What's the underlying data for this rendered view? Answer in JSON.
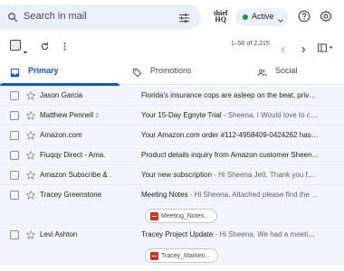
{
  "search": {
    "placeholder": "Search in mail"
  },
  "logo": {
    "line1": "thief",
    "line2": "HQ"
  },
  "status": {
    "label": "Active",
    "color": "#1e8e3e"
  },
  "toolbar": {
    "range": "1–50 of 2,215"
  },
  "tabs": [
    {
      "label": "Primary",
      "icon": "inbox-icon",
      "active": true
    },
    {
      "label": "Promotions",
      "icon": "tag-icon",
      "active": false
    },
    {
      "label": "Social",
      "icon": "people-icon",
      "active": false
    }
  ],
  "emails": [
    {
      "sender": "Jason Garcia",
      "count": "",
      "subject": "Florida's insurance cops are asleep on the beat, priva...",
      "preview": ""
    },
    {
      "sender": "Matthew Pennell",
      "count": "2",
      "subject": "Your 15-Day Egnyte Trial",
      "preview": " - Sheena, I Would love to con..."
    },
    {
      "sender": "Amazon.com",
      "count": "",
      "subject": "Your Amazon.com order #112-4958409-0424262 has ...",
      "preview": ""
    },
    {
      "sender": "Fiuqqy Direct - Ama.",
      "count": "",
      "subject": "Product details inquiry from Amazon customer Sheen...",
      "preview": ""
    },
    {
      "sender": "Amazon Subscribe & .",
      "count": "",
      "subject": "Your new subscription",
      "preview": " - Hi Sheena Jett, Thank you for ..."
    },
    {
      "sender": "Tracey Greenstone",
      "count": "",
      "subject": "Meeting Notes",
      "preview": " - Hi Sheena, Attached please find the ...",
      "attachment": "Meeting_Notes..."
    },
    {
      "sender": "Levi Ashton",
      "count": "",
      "subject": "Tracey Project Update",
      "preview": " - Hi Sheena, We had a meeting...",
      "attachment": "Tracey_Marketi..."
    }
  ]
}
